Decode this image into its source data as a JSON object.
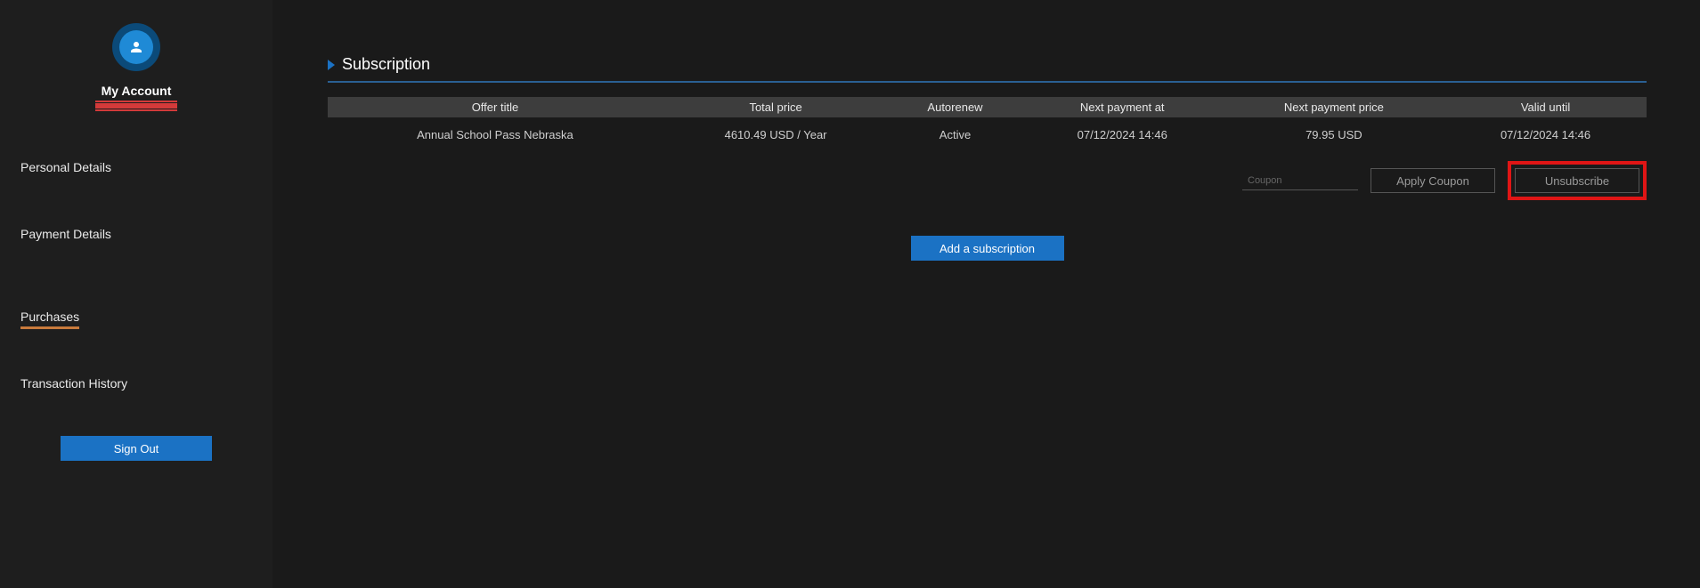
{
  "sidebar": {
    "account_label": "My Account",
    "nav": {
      "personal": "Personal Details",
      "payment": "Payment Details",
      "purchases": "Purchases",
      "transactions": "Transaction History"
    },
    "signout": "Sign Out"
  },
  "main": {
    "section_title": "Subscription",
    "table": {
      "headers": {
        "offer": "Offer title",
        "total": "Total price",
        "autorenew": "Autorenew",
        "next_at": "Next payment at",
        "next_price": "Next payment price",
        "valid_until": "Valid until"
      },
      "row": {
        "offer": "Annual School Pass Nebraska",
        "total": "4610.49 USD / Year",
        "autorenew": "Active",
        "next_at": "07/12/2024 14:46",
        "next_price": "79.95 USD",
        "valid_until": "07/12/2024 14:46"
      }
    },
    "coupon_placeholder": "Coupon",
    "apply_coupon": "Apply Coupon",
    "unsubscribe": "Unsubscribe",
    "add_subscription": "Add a subscription"
  }
}
